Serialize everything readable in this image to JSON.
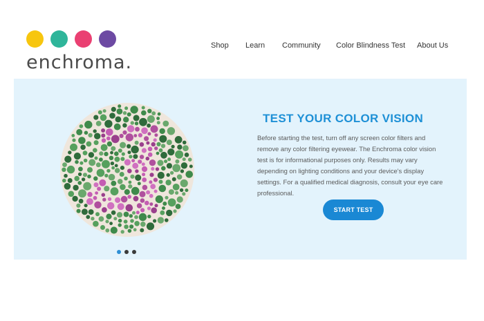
{
  "brand": {
    "name": "enchroma.",
    "dot_colors": [
      "#f7c60f",
      "#2fb59a",
      "#ea4072",
      "#6d4aa3"
    ]
  },
  "nav": {
    "items": [
      {
        "label": "Shop"
      },
      {
        "label": "Learn"
      },
      {
        "label": "Community"
      },
      {
        "label": "Color Blindness Test"
      },
      {
        "label": "About Us"
      }
    ]
  },
  "hero": {
    "title": "TEST YOUR COLOR VISION",
    "description": "Before starting the test, turn off any screen color filters and remove any color filtering eyewear. The Enchroma color vision test is for informational purposes only. Results may vary depending on lighting conditions and your device's display settings. For a qualified medical diagnosis, consult your eye care professional.",
    "cta_label": "START TEST",
    "plate_icon": "ishihara-color-plate",
    "colors": {
      "background": "#e3f3fc",
      "accent": "#1e90d6",
      "button": "#1a88d4",
      "plate_green": [
        "#3f8a4b",
        "#56a05e",
        "#2f6b3b",
        "#6aa86d"
      ],
      "plate_magenta": [
        "#b0509e",
        "#c45db3",
        "#9a3f8c",
        "#d070c0"
      ]
    },
    "carousel": {
      "total": 3,
      "active": 1
    }
  }
}
